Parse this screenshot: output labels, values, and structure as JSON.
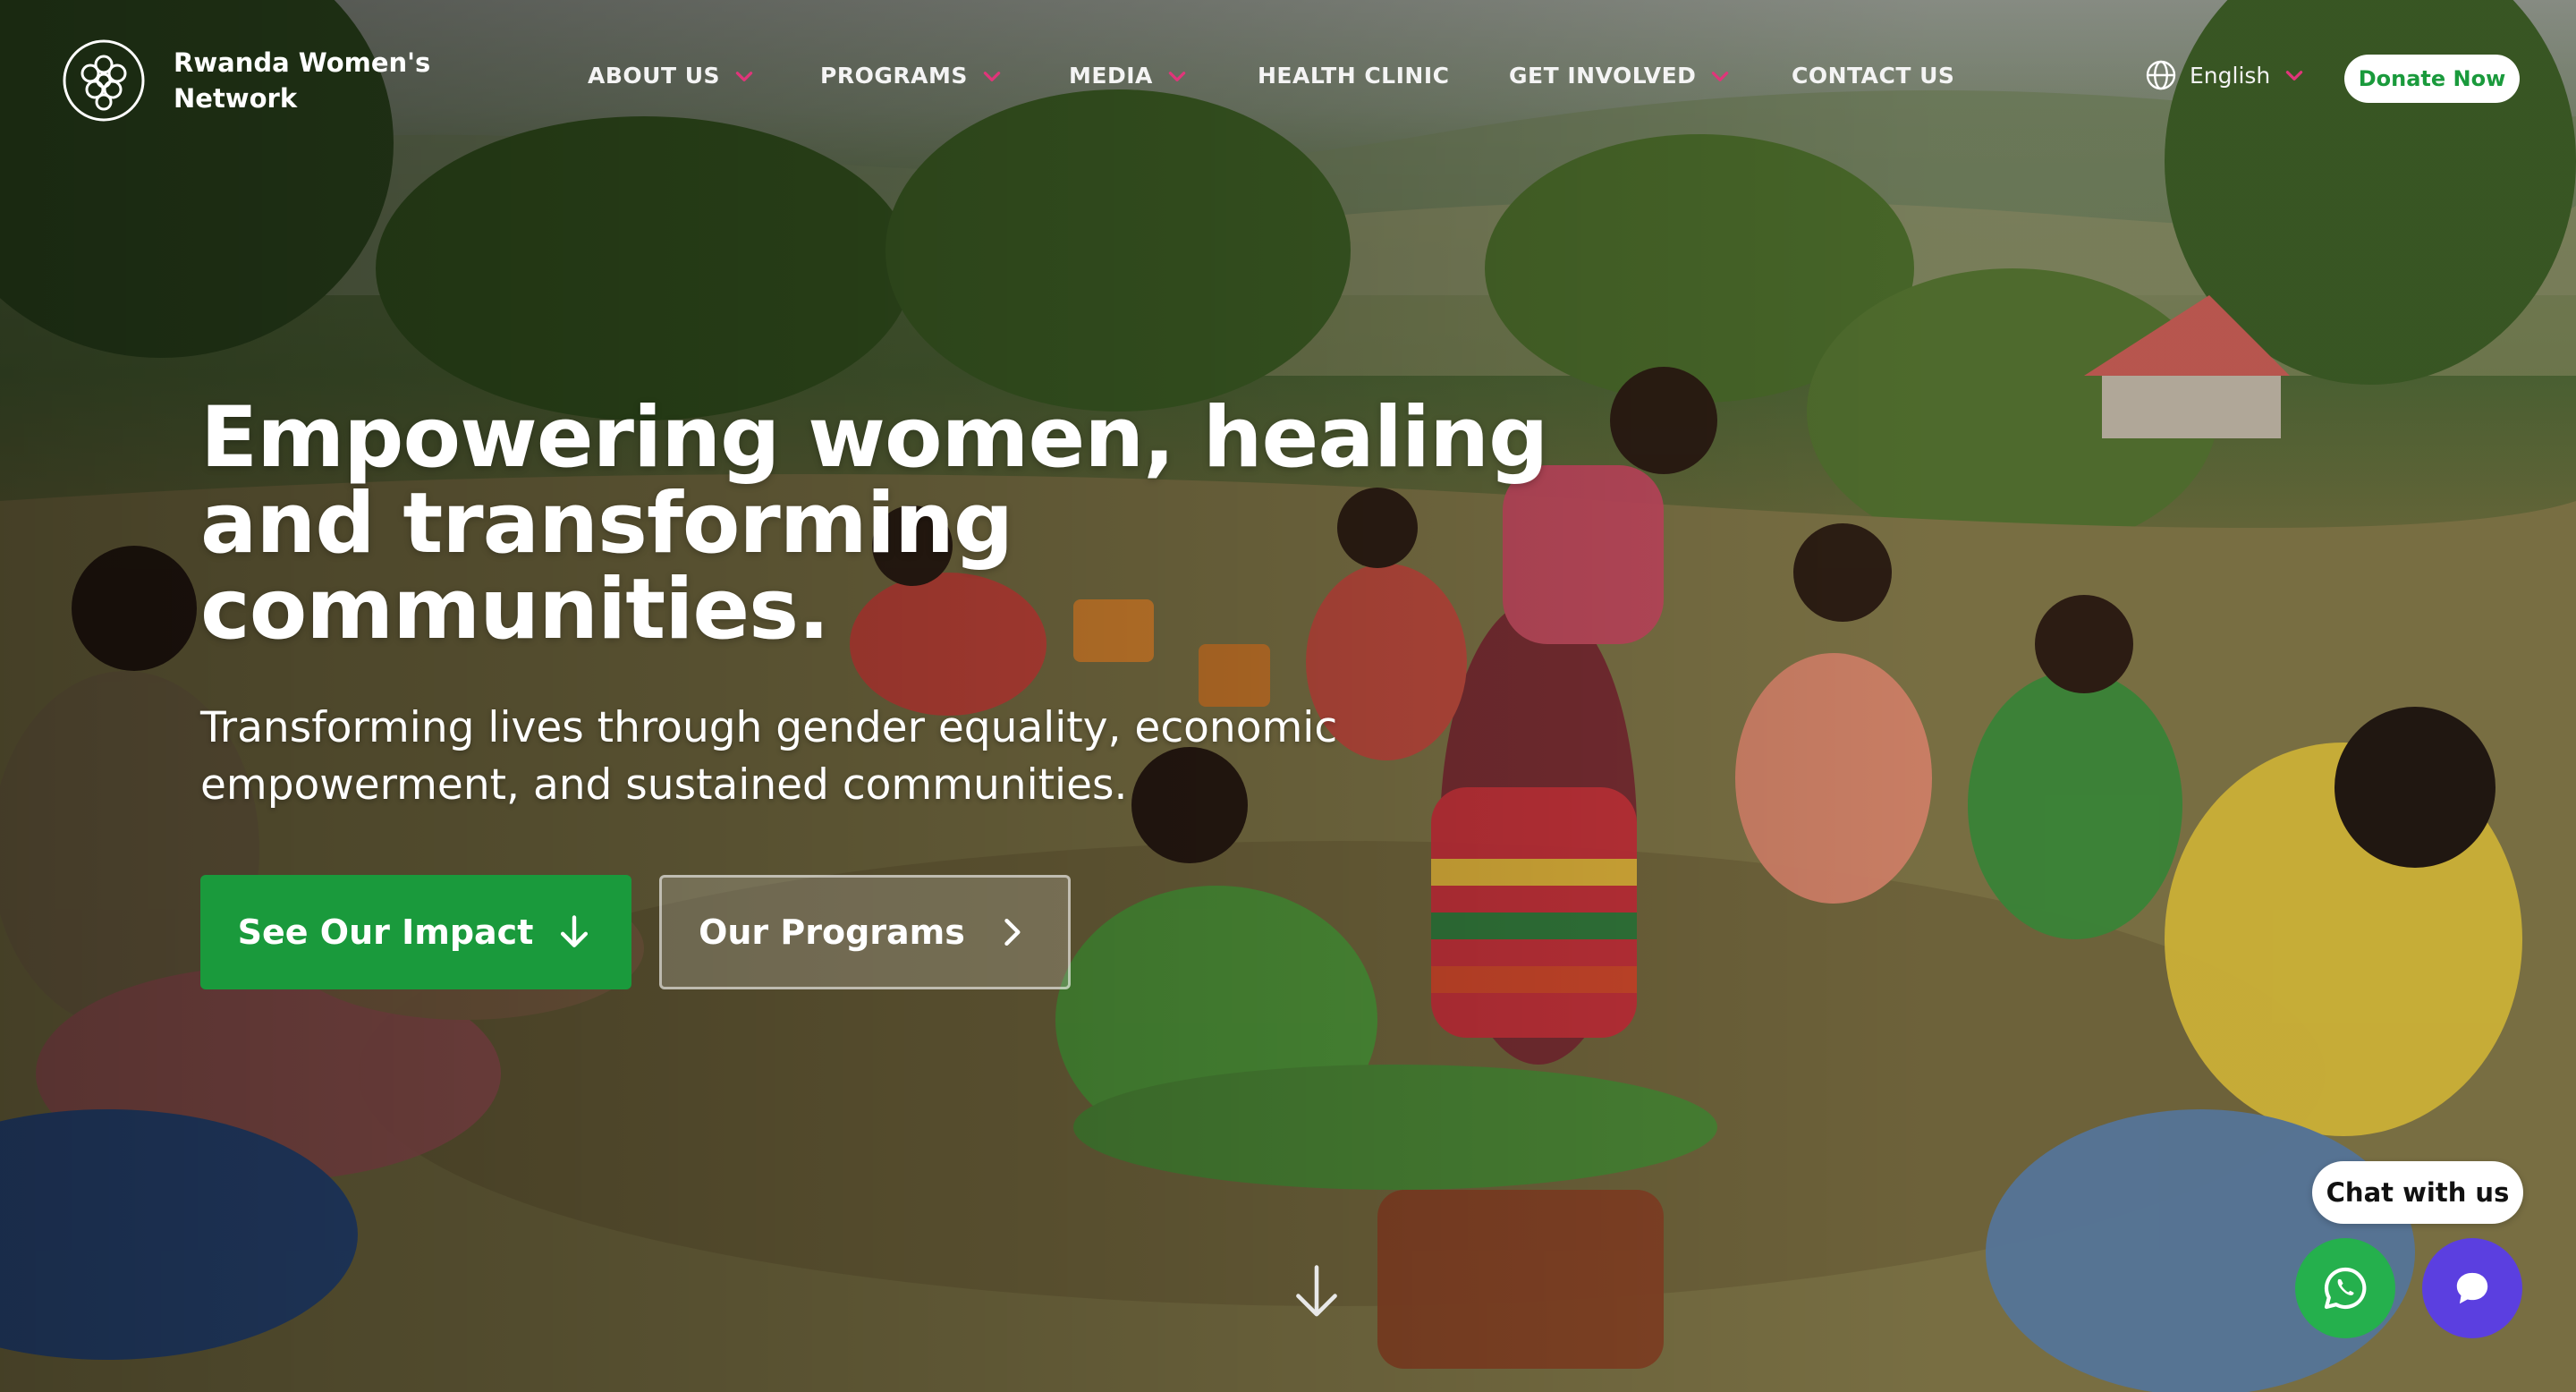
{
  "brand": {
    "name_line1": "Rwanda Women's",
    "name_line2": "Network"
  },
  "nav": {
    "items": [
      {
        "label": "ABOUT US",
        "has_dropdown": true
      },
      {
        "label": "PROGRAMS",
        "has_dropdown": true
      },
      {
        "label": "MEDIA",
        "has_dropdown": true
      },
      {
        "label": "HEALTH CLINIC",
        "has_dropdown": false
      },
      {
        "label": "GET INVOLVED",
        "has_dropdown": true
      },
      {
        "label": "CONTACT US",
        "has_dropdown": false
      }
    ],
    "language": "English",
    "donate_label": "Donate Now"
  },
  "hero": {
    "headline_line1": "Empowering women, healing",
    "headline_line2": "and transforming",
    "headline_line3": "communities.",
    "subtext_line1": "Transforming lives through gender equality, economic",
    "subtext_line2": "empowerment, and sustained communities.",
    "primary_button": "See Our Impact",
    "secondary_button": "Our Programs"
  },
  "chat": {
    "bubble_label": "Chat with us"
  },
  "colors": {
    "accent_green": "#1a9a3c",
    "dropdown_chevron": "#e0357a",
    "whatsapp_green": "#25b04d",
    "chat_purple": "#5b3fe0"
  },
  "icons": {
    "logo": "logo-mark-icon",
    "globe": "globe-icon",
    "chevron": "chevron-down-icon",
    "impact_arrow": "arrow-down-icon",
    "programs_arrow": "chevron-right-icon",
    "scroll": "arrow-down-icon",
    "whatsapp": "whatsapp-icon",
    "chat": "chat-icon"
  }
}
